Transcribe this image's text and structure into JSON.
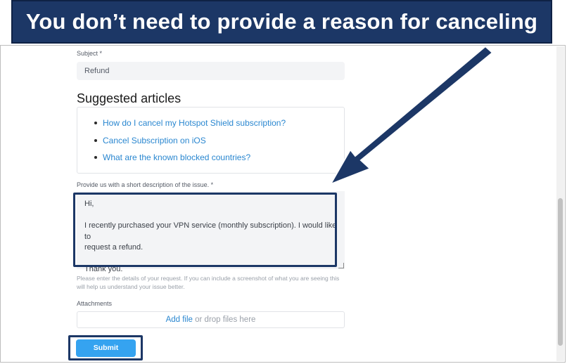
{
  "banner": {
    "text": "You don’t need to provide a reason for canceling"
  },
  "form": {
    "subject_label": "Subject *",
    "subject_value": "Refund",
    "suggested_title": "Suggested articles",
    "articles": [
      "How do I cancel my Hotspot Shield subscription?",
      "Cancel Subscription on iOS",
      "What are the known blocked countries?"
    ],
    "description_label": "Provide us with a short description of the issue. *",
    "description_lines": {
      "greeting": "Hi,",
      "body_line1": "I recently purchased your VPN service (monthly subscription). I would like to",
      "body_line2": "request a refund.",
      "closing": "Thank you."
    },
    "help_text": "Please enter the details of your request. If you can include a screenshot of what you are seeing this will help us understand your issue better.",
    "attachments_label": "Attachments",
    "add_file": "Add file",
    "drop_text": "or drop files here",
    "submit_label": "Submit"
  },
  "colors": {
    "banner_bg": "#1c3766",
    "link": "#2a87d0",
    "submit_bg": "#35a3f0"
  }
}
